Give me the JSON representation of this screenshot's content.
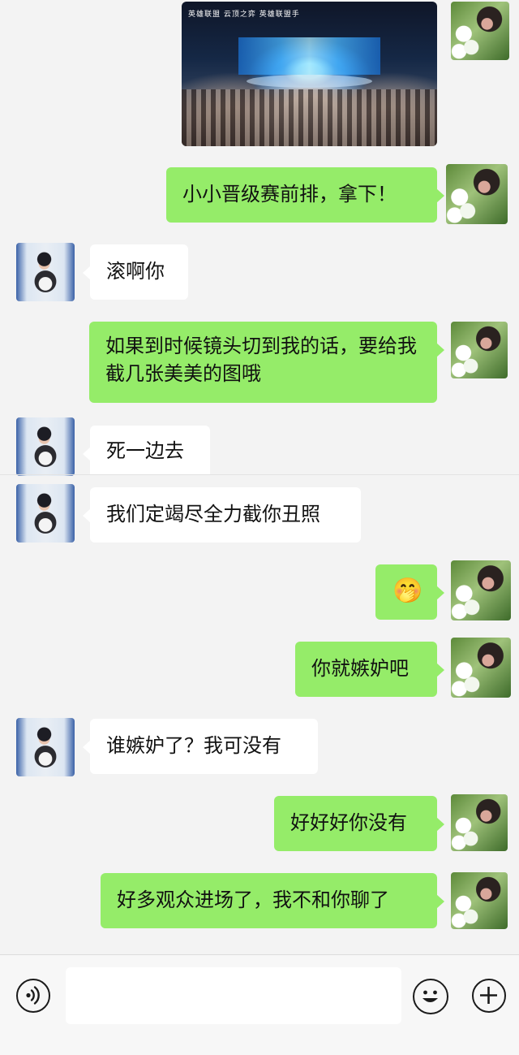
{
  "messages": {
    "m1": "小小晋级赛前排，拿下！",
    "m2": "滚啊你",
    "m3": "如果到时候镜头切到我的话，要给我截几张美美的图哦",
    "m4": "死一边去",
    "m5": "我们定竭尽全力截你丑照",
    "m6": "🤭",
    "m7": "你就嫉妒吧",
    "m8": "谁嫉妒了？我可没有",
    "m9": "好好好你没有",
    "m10": "好多观众进场了，我不和你聊了"
  },
  "photo": {
    "logos": "英雄联盟  云顶之弈  英雄联盟手"
  },
  "input_bar": {
    "voice_icon": "voice-icon",
    "emoji_icon": "emoji-icon",
    "plus_icon": "plus-icon",
    "placeholder": ""
  },
  "colors": {
    "my_bubble": "#95ec69",
    "their_bubble": "#ffffff",
    "background": "#f3f3f3"
  }
}
